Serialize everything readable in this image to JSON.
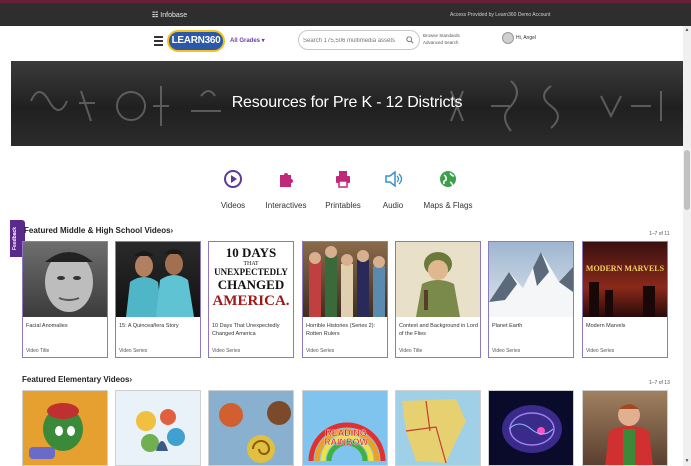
{
  "topbar": {
    "brand_mark": "☷",
    "brand": "Infobase",
    "access": "Access Provided by Learn360 Demo Account"
  },
  "header": {
    "logo": "LEARN360",
    "grades": "All Grades ▾",
    "search_placeholder": "Search 175,506 multimedia assets",
    "browse_standards": "Browse Standards",
    "advanced_search": "Advanced Search",
    "user_greeting": "Hi, Angel"
  },
  "hero": {
    "title": "Resources for Pre K - 12 Districts"
  },
  "categories": [
    {
      "label": "Videos",
      "icon": "play-circle-icon",
      "color": "#5b3a9c"
    },
    {
      "label": "Interactives",
      "icon": "puzzle-icon",
      "color": "#c2287a"
    },
    {
      "label": "Printables",
      "icon": "printer-icon",
      "color": "#c2287a"
    },
    {
      "label": "Audio",
      "icon": "speaker-icon",
      "color": "#3a8fc7"
    },
    {
      "label": "Maps & Flags",
      "icon": "globe-icon",
      "color": "#3aa14a"
    }
  ],
  "feedback": "Feedback",
  "featured_ms": {
    "title": "Featured Middle & High School Videos",
    "chevron": "›",
    "count": "1–7 of 11",
    "cards": [
      {
        "title": "Facial Anomalies",
        "type": "Video Title"
      },
      {
        "title": "15: A Quinceañera Story",
        "type": "Video Series"
      },
      {
        "title": "10 Days That Unexpectedly Changed America",
        "type": "Video Series",
        "art": [
          "10 DAYS",
          "THAT",
          "UNEXPECTEDLY",
          "CHANGED",
          "AMERICA."
        ]
      },
      {
        "title": "Horrible Histories (Series 2): Rotten Rulers",
        "type": "Video Series"
      },
      {
        "title": "Context and Background in Lord of the Flies",
        "type": "Video Title"
      },
      {
        "title": "Planet Earth",
        "type": "Video Series"
      },
      {
        "title": "Modern Marvels",
        "type": "Video Series",
        "art": "MODERN MARVELS"
      }
    ]
  },
  "featured_el": {
    "title": "Featured Elementary Videos",
    "chevron": "›",
    "count": "1–7 of 13",
    "cards": [
      {
        "art": ""
      },
      {
        "art": ""
      },
      {
        "art": ""
      },
      {
        "art": "READING RAINBOW"
      },
      {
        "art": ""
      },
      {
        "art": ""
      },
      {
        "art": ""
      }
    ]
  },
  "colors": {
    "accent": "#5b3a9c",
    "card_border": "#8d79c0",
    "topbar": "#2e2e2e"
  }
}
